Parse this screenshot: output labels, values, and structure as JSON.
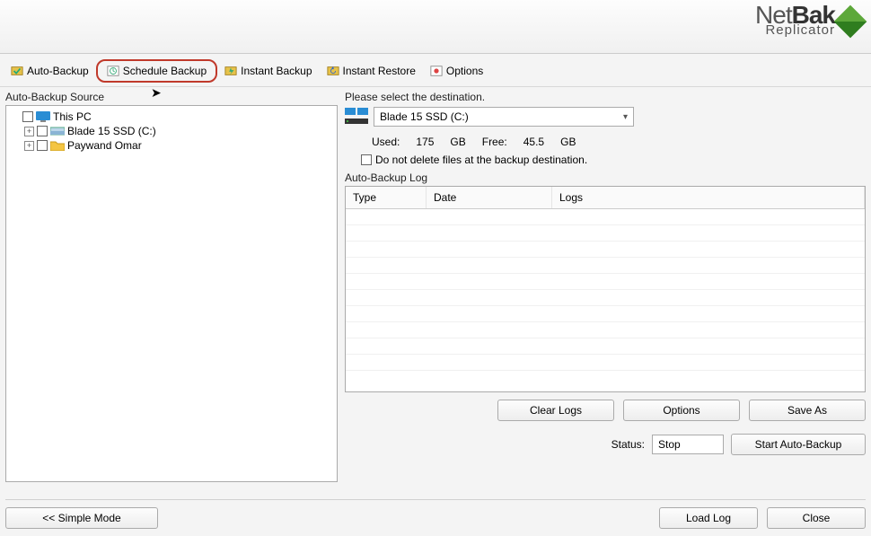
{
  "brand": {
    "net": "Net",
    "bak": "Bak",
    "sub": "Replicator"
  },
  "toolbar": {
    "auto_backup": "Auto-Backup",
    "schedule_backup": "Schedule Backup",
    "instant_backup": "Instant Backup",
    "instant_restore": "Instant Restore",
    "options": "Options"
  },
  "left": {
    "label": "Auto-Backup Source",
    "tree": {
      "root": "This PC",
      "children": [
        "Blade 15 SSD (C:)",
        "Paywand Omar"
      ]
    }
  },
  "right": {
    "prompt": "Please select the destination.",
    "dest_selected": "Blade 15 SSD (C:)",
    "stats": {
      "used_label": "Used:",
      "used_value": "175",
      "used_unit": "GB",
      "free_label": "Free:",
      "free_value": "45.5",
      "free_unit": "GB"
    },
    "dont_delete": "Do not delete files at the backup destination.",
    "log_label": "Auto-Backup Log",
    "columns": {
      "type": "Type",
      "date": "Date",
      "logs": "Logs"
    },
    "buttons": {
      "clear_logs": "Clear Logs",
      "options": "Options",
      "save_as": "Save As"
    },
    "status_label": "Status:",
    "status_value": "Stop",
    "start_button": "Start Auto-Backup"
  },
  "footer": {
    "simple_mode": "<< Simple Mode",
    "load_log": "Load Log",
    "close": "Close"
  }
}
